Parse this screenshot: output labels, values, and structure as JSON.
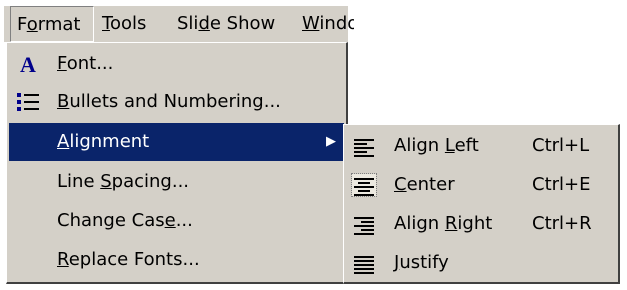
{
  "menubar": {
    "format": {
      "pre": "F",
      "u": "o",
      "post": "rmat"
    },
    "tools": {
      "pre": "",
      "u": "T",
      "post": "ools"
    },
    "slideshow": {
      "pre": "Sli",
      "u": "d",
      "post": "e Show"
    },
    "window": {
      "pre": "",
      "u": "W",
      "post": "indo"
    }
  },
  "format_menu": {
    "items": [
      {
        "icon": "font-icon",
        "pre": "",
        "u": "F",
        "post": "ont..."
      },
      {
        "icon": "bullets-icon",
        "pre": "",
        "u": "B",
        "post": "ullets and Numbering..."
      },
      {
        "icon": "",
        "pre": "",
        "u": "A",
        "post": "lignment",
        "submenu_arrow": "▶"
      },
      {
        "icon": "",
        "pre": "Line ",
        "u": "S",
        "post": "pacing..."
      },
      {
        "icon": "",
        "pre": "Change Cas",
        "u": "e",
        "post": "..."
      },
      {
        "icon": "",
        "pre": "",
        "u": "R",
        "post": "eplace Fonts..."
      }
    ]
  },
  "alignment_submenu": {
    "items": [
      {
        "icon": "align-left-icon",
        "pre": "Align ",
        "u": "L",
        "post": "eft",
        "shortcut": "Ctrl+L"
      },
      {
        "icon": "align-center-icon",
        "pre": "",
        "u": "C",
        "post": "enter",
        "shortcut": "Ctrl+E",
        "checked": true
      },
      {
        "icon": "align-right-icon",
        "pre": "Align ",
        "u": "R",
        "post": "ight",
        "shortcut": "Ctrl+R"
      },
      {
        "icon": "justify-icon",
        "pre": "",
        "u": "J",
        "post": "ustify",
        "shortcut": ""
      }
    ]
  },
  "colors": {
    "menu_bg": "#d4d0c8",
    "highlight": "#0a246a",
    "icon_blue": "#00008b"
  }
}
